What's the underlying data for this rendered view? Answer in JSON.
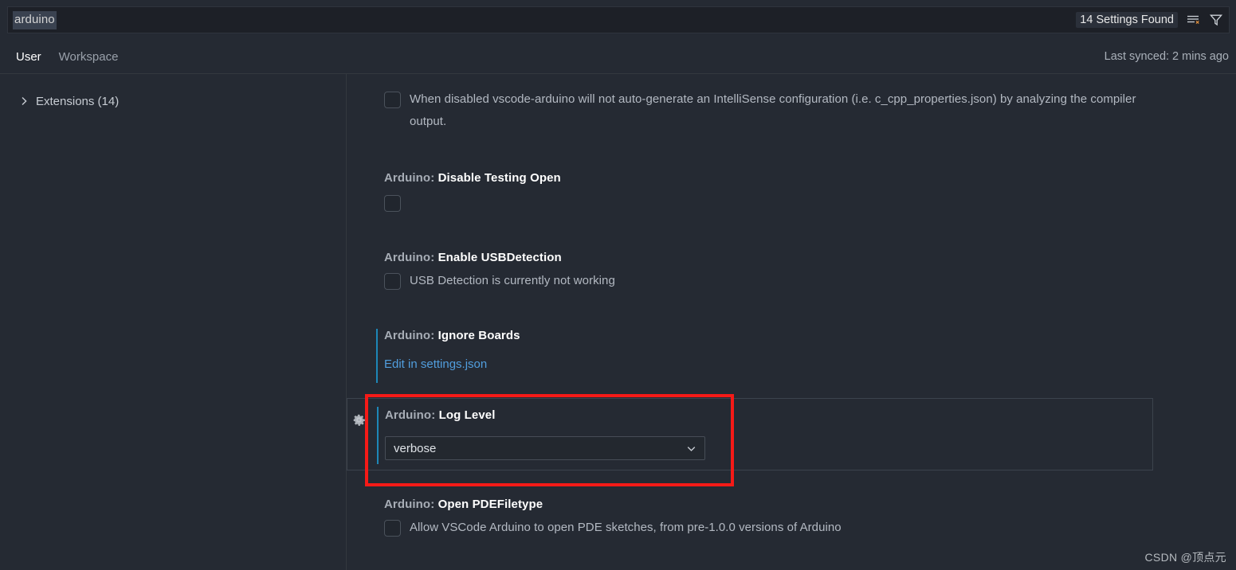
{
  "search": {
    "value": "arduino",
    "placeholder": "Search settings",
    "results_label": "14 Settings Found",
    "clear_filter_icon": "clear-filter-icon",
    "filter_icon": "filter-funnel-icon"
  },
  "tabs": [
    {
      "label": "User",
      "active": true
    },
    {
      "label": "Workspace",
      "active": false
    }
  ],
  "sync": {
    "status": "Last synced: 2 mins ago"
  },
  "toc": {
    "items": [
      {
        "label": "Extensions (14)",
        "icon": "chevron-right-icon",
        "expanded": false
      }
    ]
  },
  "settings": [
    {
      "id": "intellisense-autogen",
      "category": "",
      "name": "",
      "description": "When disabled vscode-arduino will not auto-generate an IntelliSense configuration (i.e. c_cpp_properties.json) by analyzing the compiler output.",
      "control": "checkbox",
      "checked": false,
      "modified": false
    },
    {
      "id": "disable-testing-open",
      "category": "Arduino: ",
      "name": "Disable Testing Open",
      "description": "",
      "control": "checkbox",
      "checked": false,
      "modified": false
    },
    {
      "id": "enable-usb-detection",
      "category": "Arduino: ",
      "name": "Enable USBDetection",
      "description": "USB Detection is currently not working",
      "control": "checkbox",
      "checked": false,
      "modified": false
    },
    {
      "id": "ignore-boards",
      "category": "Arduino: ",
      "name": "Ignore Boards",
      "description": "",
      "control": "json-link",
      "link_label": "Edit in settings.json",
      "modified": true
    },
    {
      "id": "log-level",
      "category": "Arduino: ",
      "name": "Log Level",
      "description": "",
      "control": "dropdown",
      "value": "verbose",
      "chevron_icon": "chevron-down-icon",
      "gear_icon": "gear-icon",
      "modified": true,
      "focused": true,
      "annotated": true
    },
    {
      "id": "open-pde-filetype",
      "category": "Arduino: ",
      "name": "Open PDEFiletype",
      "description": "Allow VSCode Arduino to open PDE sketches, from pre-1.0.0 versions of Arduino",
      "control": "checkbox",
      "checked": false,
      "modified": false
    }
  ],
  "watermark": "CSDN @顶点元",
  "colors": {
    "background": "#252a33",
    "input_background": "#1d2027",
    "accent_link": "#519ede",
    "modified_indicator": "#1d87b8",
    "annotation": "#f51a17"
  }
}
